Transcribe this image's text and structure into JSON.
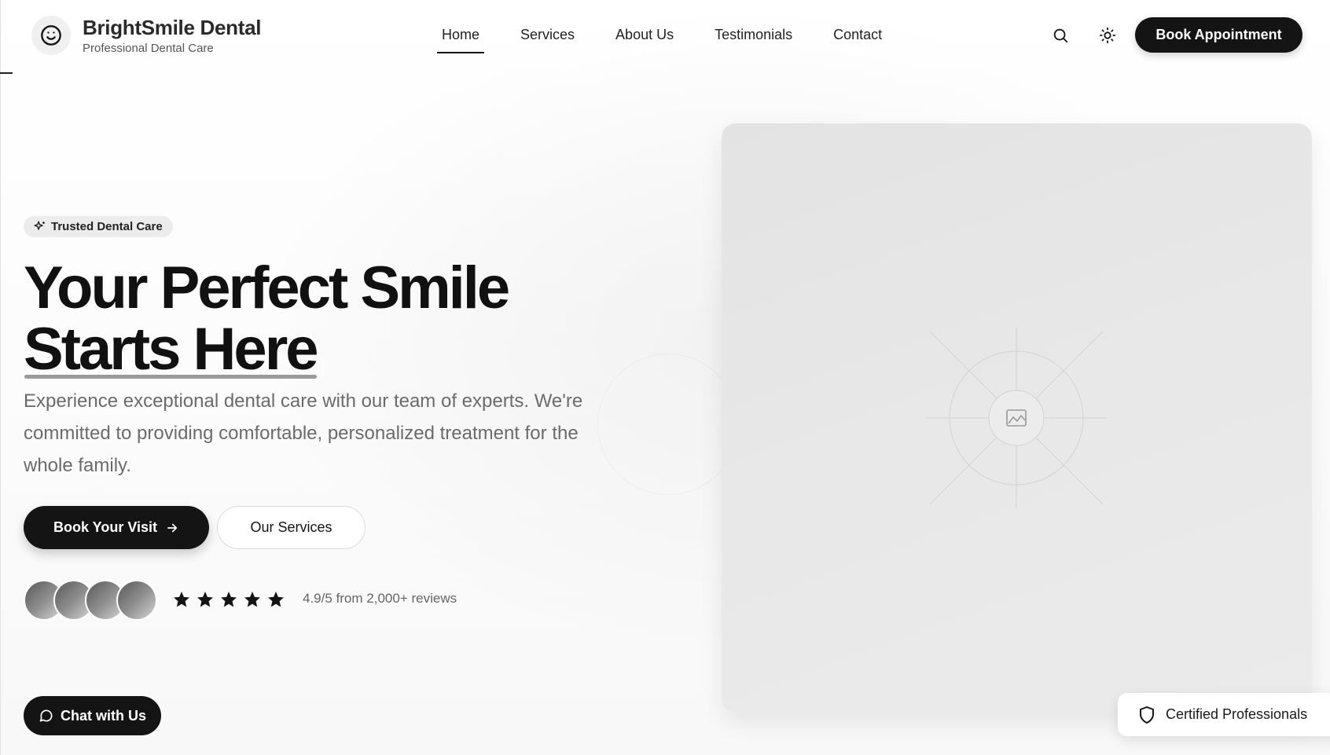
{
  "header": {
    "brand_name": "BrightSmile Dental",
    "brand_tagline": "Professional Dental Care",
    "nav": [
      {
        "label": "Home",
        "active": true
      },
      {
        "label": "Services",
        "active": false
      },
      {
        "label": "About Us",
        "active": false
      },
      {
        "label": "Testimonials",
        "active": false
      },
      {
        "label": "Contact",
        "active": false
      }
    ],
    "book_button": "Book Appointment",
    "icons": [
      "search-icon",
      "sun-icon"
    ]
  },
  "hero": {
    "badge": "Trusted Dental Care",
    "title_line1": "Your Perfect Smile",
    "title_line2": "Starts Here",
    "description": "Experience exceptional dental care with our team of experts. We're committed to providing comfortable, personalized treatment for the whole family.",
    "primary_button": "Book Your Visit",
    "secondary_button": "Our Services",
    "rating_value": "4.9/5",
    "rating_from": "from",
    "rating_count": "2,000+",
    "rating_suffix": "reviews",
    "stars": 5,
    "avatar_count": 4
  },
  "image_card": {
    "icon": "image-icon"
  },
  "certified_badge": "Certified Professionals",
  "chat_button": "Chat with Us",
  "colors": {
    "primary": "#141414",
    "background": "#ffffff",
    "muted_text": "#6b6b6b",
    "placeholder": "#e5e5e5"
  }
}
